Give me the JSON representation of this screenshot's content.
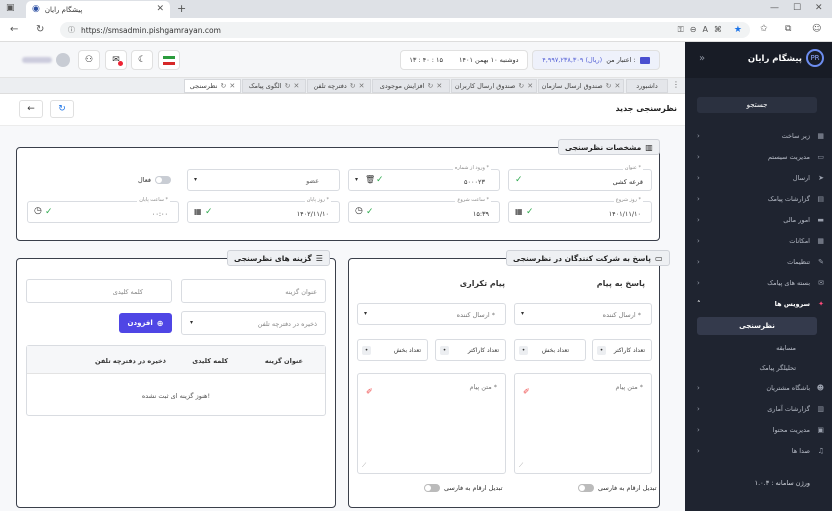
{
  "browser": {
    "tab_title": "پیشگام رایان",
    "url": "https://smsadmin.pishgamrayan.com"
  },
  "sidebar": {
    "brand": "پیشگام رایان",
    "search": "جستجو",
    "items": [
      {
        "label": "زیر ساخت",
        "icon": "building-icon"
      },
      {
        "label": "مدیریت سیستم",
        "icon": "monitor-icon"
      },
      {
        "label": "ارسال",
        "icon": "send-icon"
      },
      {
        "label": "گزارشات پیامک",
        "icon": "report-icon"
      },
      {
        "label": "امور مالی",
        "icon": "money-icon"
      },
      {
        "label": "امکانات",
        "icon": "grid-icon"
      },
      {
        "label": "تنظیمات",
        "icon": "wrench-icon"
      },
      {
        "label": "بسته های پیامک",
        "icon": "package-icon"
      },
      {
        "label": "سرویس ها",
        "icon": "sparkle-icon"
      },
      {
        "label": "نظرسنجی",
        "icon": ""
      },
      {
        "label": "مسابقه",
        "icon": ""
      },
      {
        "label": "تحلیلگر پیامک",
        "icon": ""
      },
      {
        "label": "باشگاه مشتریان",
        "icon": "users-icon"
      },
      {
        "label": "گزارشات آماری",
        "icon": "chart-icon"
      },
      {
        "label": "مدیریت محتوا",
        "icon": "folder-icon"
      },
      {
        "label": "صدا ها",
        "icon": "audio-icon"
      }
    ],
    "version": "ورژن سامانه : ۱.۰.۳"
  },
  "header": {
    "credit_label": "اعتبار من :",
    "credit_value": "۴,۹۹۷,۲۳۸,۳۰۹ (ریال)",
    "date": "دوشنبه ۱۰ بهمن ۱۴۰۱",
    "time": "۱۳ : ۴۰ : ۱۵"
  },
  "tabs": [
    {
      "label": "داشبورد"
    },
    {
      "label": "صندوق ارسال سازمان"
    },
    {
      "label": "صندوق ارسال کاربران"
    },
    {
      "label": "افزایش موجودی"
    },
    {
      "label": "دفترچه تلفن"
    },
    {
      "label": "الگوی پیامک"
    },
    {
      "label": "نظرسنجی"
    }
  ],
  "page": {
    "title": "نظرسنجی جدید"
  },
  "specs": {
    "title": "مشخصات نظرسنجی",
    "subject_label": "عنوان *",
    "subject_value": "قرعه کشی",
    "number_label": "ورود از شماره *",
    "number_value": "۵۰۰۰۲۳",
    "group_value": "عضو",
    "active_label": "فعال",
    "start_date_label": "روز شروع *",
    "start_date_value": "۱۴۰۱/۱۱/۱۰",
    "start_time_label": "ساعت شروع *",
    "start_time_value": "۱۵:۳۹",
    "end_date_label": "روز پایان *",
    "end_date_value": "۱۴۰۲/۱۱/۱۰",
    "end_time_label": "ساعت پایان *",
    "end_time_value": "۰۰:۰۰"
  },
  "reply": {
    "title": "پاسخ به شرکت کنندگان در نظرسنجی",
    "col1_title": "پاسخ به پیام",
    "col2_title": "پیام تکراری",
    "sender_placeholder": "ارسال کننده *",
    "char_count": "تعداد کاراکتر",
    "section_count": "تعداد بخش",
    "message_placeholder": "متن پیام *",
    "convert_label": "تبدیل ارقام به فارسی"
  },
  "options": {
    "title": "گزینه های نظرسنجی",
    "option_title_placeholder": "عنوان گزینه",
    "keyword_placeholder": "کلمه کلیدی",
    "save_placeholder": "ذخیره در دفترچه تلفن",
    "add_button": "افزودن",
    "columns": [
      "عنوان گزینه",
      "کلمه کلیدی",
      "ذخیره در دفترچه تلفن"
    ],
    "empty": "هنوز گزینه ای ثبت نشده!"
  }
}
